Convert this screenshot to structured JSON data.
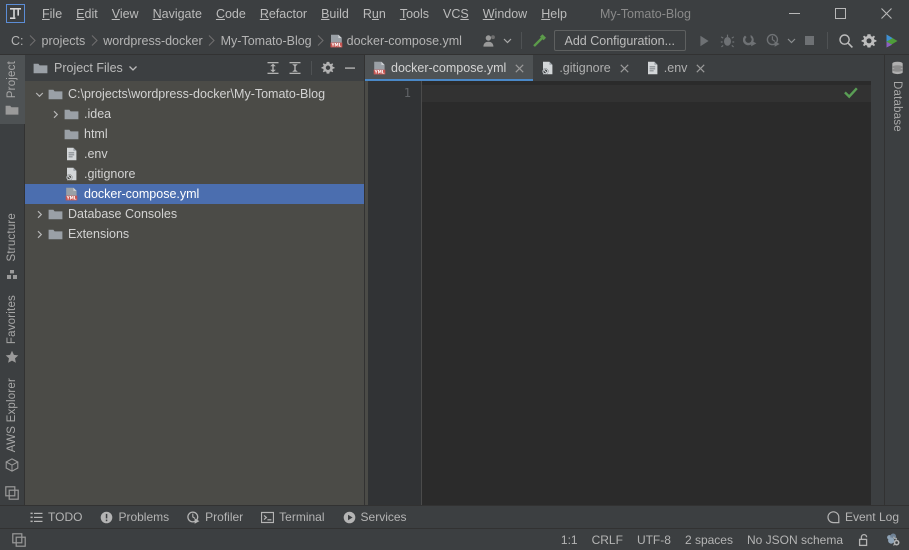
{
  "window": {
    "title": "My-Tomato-Blog",
    "logo_text": "IJ",
    "minimize_label": "Minimize",
    "maximize_label": "Maximize",
    "close_label": "Close"
  },
  "menubar": {
    "items": [
      {
        "label": "File",
        "mnemonic": "F"
      },
      {
        "label": "Edit",
        "mnemonic": "E"
      },
      {
        "label": "View",
        "mnemonic": "V"
      },
      {
        "label": "Navigate",
        "mnemonic": "N"
      },
      {
        "label": "Code",
        "mnemonic": "C"
      },
      {
        "label": "Refactor",
        "mnemonic": "R"
      },
      {
        "label": "Build",
        "mnemonic": "B"
      },
      {
        "label": "Run",
        "mnemonic": "u"
      },
      {
        "label": "Tools",
        "mnemonic": "T"
      },
      {
        "label": "VCS",
        "mnemonic": "S"
      },
      {
        "label": "Window",
        "mnemonic": "W"
      },
      {
        "label": "Help",
        "mnemonic": "H"
      }
    ]
  },
  "navbar": {
    "breadcrumbs": [
      {
        "label": "C:",
        "icon": null
      },
      {
        "label": "projects",
        "icon": null
      },
      {
        "label": "wordpress-docker",
        "icon": null
      },
      {
        "label": "My-Tomato-Blog",
        "icon": null
      },
      {
        "label": "docker-compose.yml",
        "icon": "yml-file-icon"
      }
    ],
    "toolbar": {
      "avatar_icon": "user-avatar-icon",
      "avatar_dropdown_icon": "chevron-down-icon",
      "build_icon": "build-hammer-icon",
      "add_configuration_label": "Add Configuration...",
      "run_icon": "run-play-icon",
      "debug_icon": "debug-bug-icon",
      "run_coverage_icon": "run-with-coverage-icon",
      "profile_icon": "profile-icon",
      "profile_dropdown_icon": "chevron-down-icon",
      "stop_icon": "stop-square-icon",
      "search_icon": "search-icon",
      "settings_icon": "gear-icon",
      "updates_icon": "ide-update-icon"
    }
  },
  "left_stripe": {
    "items": [
      {
        "label": "Project",
        "icon": "project-folder-icon",
        "active": true
      },
      {
        "label": "Structure",
        "icon": "structure-icon",
        "active": false
      },
      {
        "label": "Favorites",
        "icon": "star-icon",
        "active": false
      },
      {
        "label": "AWS Explorer",
        "icon": "aws-cube-icon",
        "active": false
      }
    ],
    "bottom_icon": "layout-toggle-icon"
  },
  "right_stripe": {
    "items": [
      {
        "label": "Database",
        "icon": "database-icon",
        "active": false
      }
    ]
  },
  "project_panel": {
    "header": {
      "icon": "folder-icon",
      "title": "Project Files",
      "dropdown_icon": "chevron-down-icon",
      "expand_all_icon": "expand-all-icon",
      "collapse_all_icon": "collapse-all-icon",
      "settings_icon": "gear-icon",
      "hide_icon": "minimize-icon"
    },
    "tree": [
      {
        "label": "C:\\projects\\wordpress-docker\\My-Tomato-Blog",
        "icon": "folder-icon",
        "indent": 0,
        "arrow": "expanded",
        "selected": false
      },
      {
        "label": ".idea",
        "icon": "folder-icon",
        "indent": 1,
        "arrow": "collapsed",
        "selected": false
      },
      {
        "label": "html",
        "icon": "folder-icon",
        "indent": 1,
        "arrow": "none",
        "selected": false
      },
      {
        "label": ".env",
        "icon": "env-file-icon",
        "indent": 1,
        "arrow": "none",
        "selected": false
      },
      {
        "label": ".gitignore",
        "icon": "gitignore-file-icon",
        "indent": 1,
        "arrow": "none",
        "selected": false
      },
      {
        "label": "docker-compose.yml",
        "icon": "yml-file-icon",
        "indent": 1,
        "arrow": "none",
        "selected": true
      },
      {
        "label": "Database Consoles",
        "icon": "folder-icon",
        "indent": 0,
        "arrow": "collapsed",
        "selected": false
      },
      {
        "label": "Extensions",
        "icon": "folder-icon",
        "indent": 0,
        "arrow": "collapsed",
        "selected": false
      }
    ]
  },
  "editor": {
    "tabs": [
      {
        "label": "docker-compose.yml",
        "icon": "yml-file-icon",
        "active": true,
        "close_icon": "close-icon"
      },
      {
        "label": ".gitignore",
        "icon": "gitignore-file-icon",
        "active": false,
        "close_icon": "close-icon"
      },
      {
        "label": ".env",
        "icon": "env-file-icon",
        "active": false,
        "close_icon": "close-icon"
      }
    ],
    "line_numbers": [
      "1"
    ],
    "content_lines": [
      ""
    ],
    "inspection_status_icon": "green-check-icon"
  },
  "tool_window_bar": {
    "items": [
      {
        "label": "TODO",
        "icon": "todo-list-icon"
      },
      {
        "label": "Problems",
        "icon": "problems-icon"
      },
      {
        "label": "Profiler",
        "icon": "profiler-icon"
      },
      {
        "label": "Terminal",
        "icon": "terminal-icon"
      },
      {
        "label": "Services",
        "icon": "services-icon"
      }
    ],
    "event_log": {
      "label": "Event Log",
      "icon": "event-log-icon"
    }
  },
  "status_bar": {
    "caret_position": "1:1",
    "line_separator": "CRLF",
    "encoding": "UTF-8",
    "indent": "2 spaces",
    "schema": "No JSON schema",
    "lock_icon": "unlocked-icon",
    "inspection_icon": "inspection-settings-icon"
  },
  "colors": {
    "background": "#3c3f41",
    "editor_background": "#2b2b2b",
    "tree_background": "#4b4b47",
    "selection_blue": "#4b6eaf",
    "tab_underline": "#4a88c7",
    "text": "#bbbbbb",
    "accent_green": "#499c54",
    "yml_red": "#c75450"
  }
}
